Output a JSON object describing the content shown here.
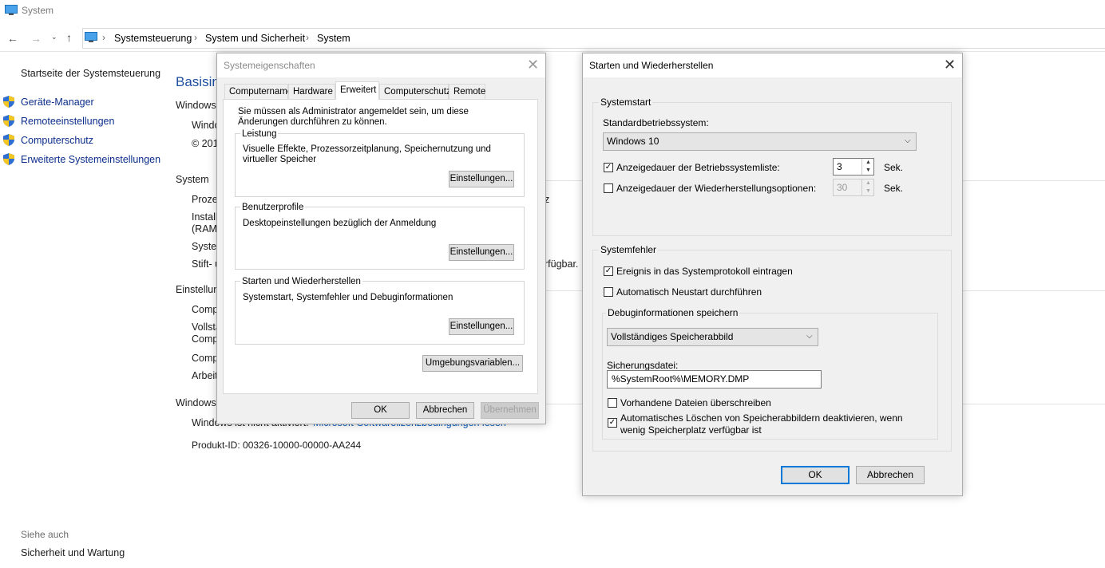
{
  "window": {
    "title": "System"
  },
  "address": {
    "crumbs": [
      "Systemsteuerung",
      "System und Sicherheit",
      "System"
    ]
  },
  "sidebar": {
    "home_link": "Startseite der Systemsteuerung",
    "items": [
      {
        "label": "Geräte-Manager"
      },
      {
        "label": "Remoteeinstellungen"
      },
      {
        "label": "Computerschutz"
      },
      {
        "label": "Erweiterte Systemeinstellungen"
      }
    ],
    "see_also_label": "Siehe auch",
    "see_also_link": "Sicherheit und Wartung"
  },
  "background": {
    "heading": "Basisinf",
    "sec_windows": "Windows-",
    "win_line1": "Windo",
    "win_line2": "© 201",
    "sec_system": "System",
    "sys_rows": [
      "Proze",
      "Install",
      "(RAM)",
      "Syster",
      "Stift- u"
    ],
    "sys_trail1": "z",
    "sys_trail2": "rfügbar.",
    "sec_settings": "Einstellun",
    "set_rows": [
      "Comp",
      "Vollstä",
      "Comp",
      "Comp",
      "Arbeit"
    ],
    "sec_activation": "Windows-",
    "activation_text": "Windows ist nicht aktiviert.",
    "activation_link": "Microsoft-Softwarelizenzbedingungen lesen",
    "product_id": "Produkt-ID:  00326-10000-00000-AA244"
  },
  "dialog_sysprops": {
    "title": "Systemeigenschaften",
    "tabs": [
      "Computername",
      "Hardware",
      "Erweitert",
      "Computerschutz",
      "Remote"
    ],
    "active_tab": "Erweitert",
    "admin_note": "Sie müssen als Administrator angemeldet sein, um diese Änderungen durchführen zu können.",
    "groups": [
      {
        "label": "Leistung",
        "text": "Visuelle Effekte, Prozessorzeitplanung, Speichernutzung und virtueller Speicher",
        "button": "Einstellungen..."
      },
      {
        "label": "Benutzerprofile",
        "text": "Desktopeinstellungen bezüglich der Anmeldung",
        "button": "Einstellungen..."
      },
      {
        "label": "Starten und Wiederherstellen",
        "text": "Systemstart, Systemfehler und Debuginformationen",
        "button": "Einstellungen..."
      }
    ],
    "env_button": "Umgebungsvariablen...",
    "ok": "OK",
    "cancel": "Abbrechen",
    "apply": "Übernehmen"
  },
  "dialog_startup": {
    "title": "Starten und Wiederherstellen",
    "systemstart": {
      "label": "Systemstart",
      "default_os_label": "Standardbetriebssystem:",
      "default_os_value": "Windows 10",
      "os_list_checkbox": {
        "label": "Anzeigedauer der Betriebssystemliste:",
        "checked": true,
        "value": "3",
        "unit": "Sek."
      },
      "recovery_checkbox": {
        "label": "Anzeigedauer der Wiederherstellungsoptionen:",
        "checked": false,
        "value": "30",
        "unit": "Sek."
      }
    },
    "systemfehler": {
      "label": "Systemfehler",
      "log_event": {
        "label": "Ereignis in das Systemprotokoll eintragen",
        "checked": true
      },
      "auto_restart": {
        "label": "Automatisch Neustart durchführen",
        "checked": false
      },
      "debug": {
        "label": "Debuginformationen speichern",
        "dump_type": "Vollständiges Speicherabbild",
        "dump_file_label": "Sicherungsdatei:",
        "dump_file_value": "%SystemRoot%\\MEMORY.DMP",
        "overwrite": {
          "label": "Vorhandene Dateien überschreiben",
          "checked": false
        },
        "disable_autodelete": {
          "label": "Automatisches Löschen von Speicherabbildern deaktivieren, wenn wenig Speicherplatz verfügbar ist",
          "checked": true
        }
      }
    },
    "ok": "OK",
    "cancel": "Abbrechen"
  },
  "colors": {
    "accent": "#0078d7",
    "link": "#0a5ec4",
    "heading": "#1e4fa0"
  }
}
